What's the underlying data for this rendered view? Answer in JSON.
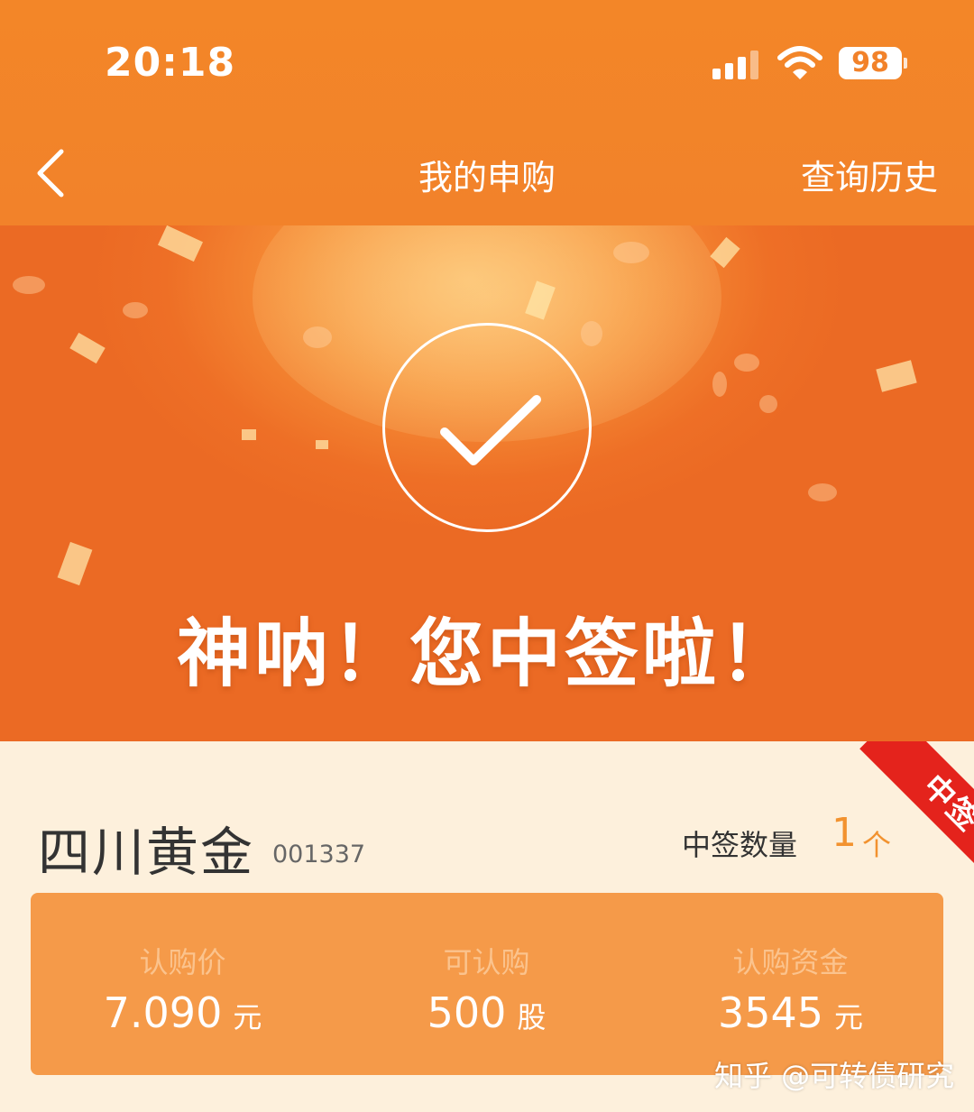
{
  "status_bar": {
    "time": "20:18",
    "battery": "98"
  },
  "nav": {
    "title": "我的申购",
    "history_label": "查询历史"
  },
  "banner": {
    "headline": "神呐！您中签啦！"
  },
  "stock": {
    "name": "四川黄金",
    "code": "001337",
    "ribbon": "中签",
    "win_label": "中签数量",
    "win_count": "1",
    "win_unit": "个"
  },
  "info": [
    {
      "label": "认购价",
      "value": "7.090",
      "unit": "元"
    },
    {
      "label": "可认购",
      "value": "500",
      "unit": "股"
    },
    {
      "label": "认购资金",
      "value": "3545",
      "unit": "元"
    }
  ],
  "watermark": "知乎 @可转债研究",
  "colors": {
    "primary_orange": "#f2822a",
    "info_box": "#f59a49",
    "ribbon": "#e4231c",
    "card_bg": "#fdf0dc"
  }
}
